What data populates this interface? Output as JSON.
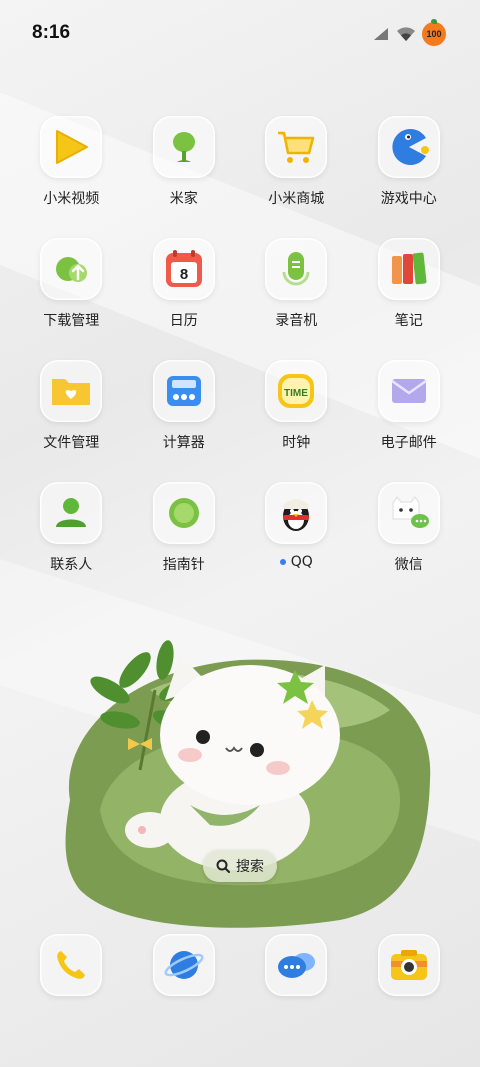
{
  "status_bar": {
    "time": "8:16",
    "battery": "100"
  },
  "apps": [
    {
      "label": "小米视频",
      "icon": "play-icon"
    },
    {
      "label": "米家",
      "icon": "lamp-icon"
    },
    {
      "label": "小米商城",
      "icon": "cart-icon"
    },
    {
      "label": "游戏中心",
      "icon": "pacman-icon"
    },
    {
      "label": "下载管理",
      "icon": "download-icon"
    },
    {
      "label": "日历",
      "icon": "calendar-icon",
      "day": "8"
    },
    {
      "label": "录音机",
      "icon": "microphone-icon"
    },
    {
      "label": "笔记",
      "icon": "notebook-icon"
    },
    {
      "label": "文件管理",
      "icon": "folder-icon"
    },
    {
      "label": "计算器",
      "icon": "calculator-icon"
    },
    {
      "label": "时钟",
      "icon": "clock-icon",
      "text": "TIME"
    },
    {
      "label": "电子邮件",
      "icon": "envelope-icon"
    },
    {
      "label": "联系人",
      "icon": "person-icon"
    },
    {
      "label": "指南针",
      "icon": "compass-icon"
    },
    {
      "label": "QQ",
      "icon": "penguin-icon"
    },
    {
      "label": "微信",
      "icon": "cat-chat-icon"
    }
  ],
  "search": {
    "label": "搜索"
  },
  "dock": [
    {
      "icon": "phone-icon"
    },
    {
      "icon": "browser-planet-icon"
    },
    {
      "icon": "messages-icon"
    },
    {
      "icon": "camera-icon"
    }
  ]
}
